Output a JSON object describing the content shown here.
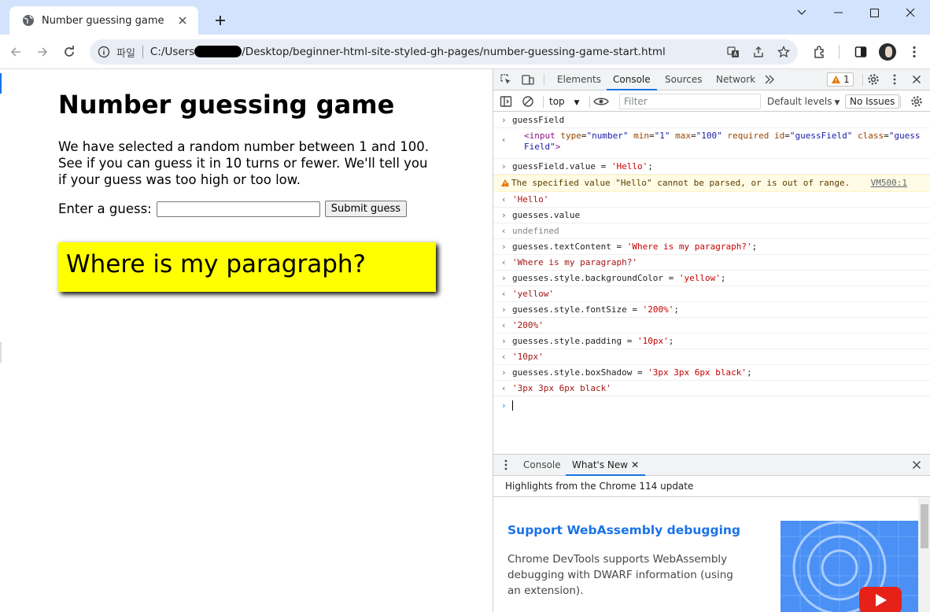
{
  "browser": {
    "tab_title": "Number guessing game",
    "omnibox": {
      "scheme_label": "파일",
      "url_prefix": "C:/Users",
      "url_suffix": "/Desktop/beginner-html-site-styled-gh-pages/number-guessing-game-start.html"
    },
    "icons": [
      "globe-icon",
      "close-icon",
      "plus-icon",
      "minimize-icon",
      "maximize-icon",
      "back-icon",
      "forward-icon",
      "reload-icon",
      "info-icon",
      "translate-icon",
      "share-icon",
      "star-icon",
      "extensions-icon",
      "side-panel-icon",
      "kebab-icon"
    ]
  },
  "page": {
    "heading": "Number guessing game",
    "intro": "We have selected a random number between 1 and 100. See if you can guess it in 10 turns or fewer. We'll tell you if your guess was too high or too low.",
    "guess_label": "Enter a guess:",
    "guess_value": "",
    "submit_label": "Submit guess",
    "guesses_text": "Where is my paragraph?",
    "guesses_bg_color": "#ffff00"
  },
  "devtools": {
    "tabs": [
      "Elements",
      "Console",
      "Sources",
      "Network"
    ],
    "active_tab": "Console",
    "warning_count": "1",
    "context": "top",
    "filter_placeholder": "Filter",
    "levels_label": "Default levels",
    "issues_label": "No Issues",
    "console": {
      "l1": "guessField",
      "l2": {
        "tag_open": "<input",
        "a1": "type",
        "v1": "\"number\"",
        "a2": "min",
        "v2": "\"1\"",
        "a3": "max",
        "v3": "\"100\"",
        "a4": "required",
        "a5": "id",
        "v5": "\"guessField\"",
        "a6": "class",
        "v6": "\"guessField\"",
        "tag_close": ">"
      },
      "l3_code": "guessField.value = ",
      "l3_str": "'Hello'",
      "l3_end": ";",
      "warn_text": "The specified value \"Hello\" cannot be parsed, or is out of range.",
      "warn_source": "VM500:1",
      "r3": "'Hello'",
      "l4": "guesses.value",
      "r4": "undefined",
      "l5_code": "guesses.textContent = ",
      "l5_str": "'Where is my paragraph?'",
      "l5_end": ";",
      "r5": "'Where is my paragraph?'",
      "l6_code": "guesses.style.backgroundColor = ",
      "l6_str": "'yellow'",
      "l6_end": ";",
      "r6": "'yellow'",
      "l7_code": "guesses.style.fontSize = ",
      "l7_str": "'200%'",
      "l7_end": ";",
      "r7": "'200%'",
      "l8_code": "guesses.style.padding = ",
      "l8_str": "'10px'",
      "l8_end": ";",
      "r8": "'10px'",
      "l9_code": "guesses.style.boxShadow = ",
      "l9_str": "'3px 3px 6px black'",
      "l9_end": ";",
      "r9": "'3px 3px 6px black'"
    },
    "drawer": {
      "tabs": [
        "Console",
        "What's New"
      ],
      "active_tab": "What's New",
      "highlights": "Highlights from the Chrome 114 update",
      "article_title": "Support WebAssembly debugging",
      "article_text": "Chrome DevTools supports WebAssembly debugging with DWARF information (using an extension)."
    }
  }
}
